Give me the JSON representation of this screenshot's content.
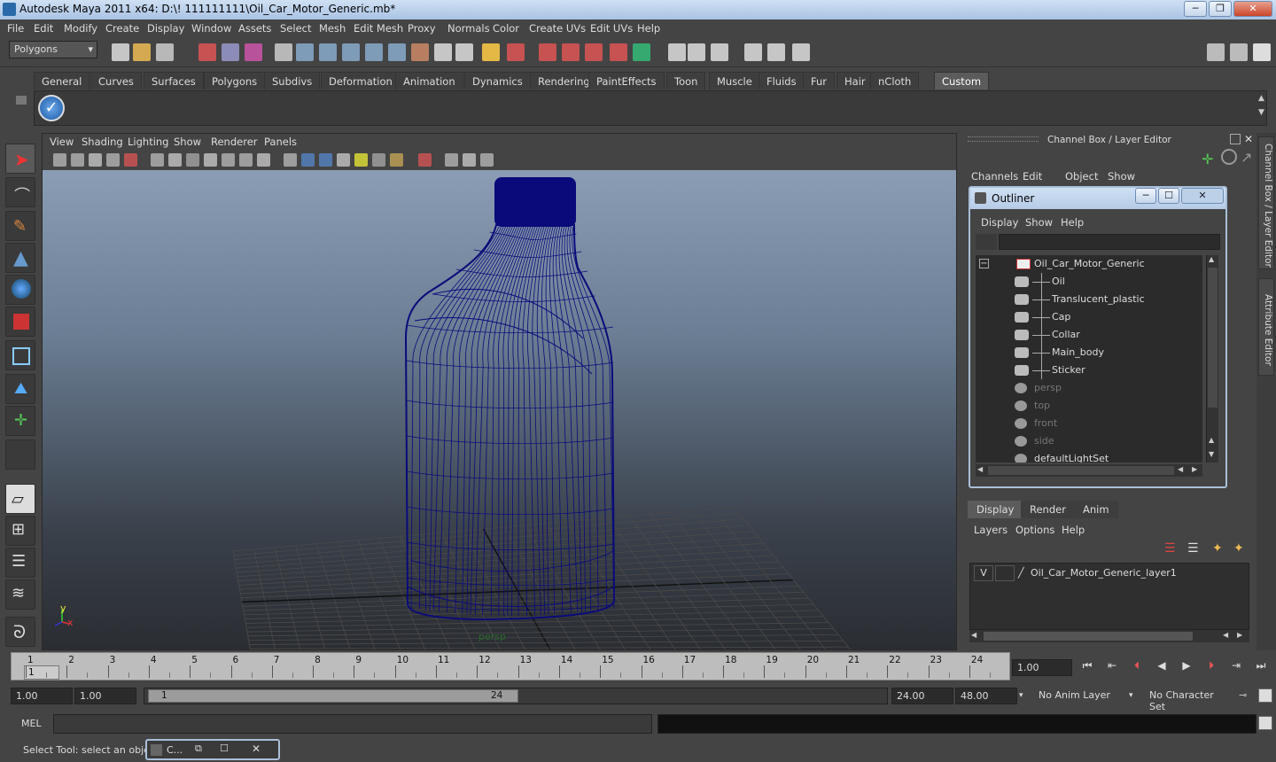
{
  "window": {
    "title": "Autodesk Maya 2011 x64: D:\\! 111111111\\Oil_Car_Motor_Generic.mb*",
    "btn_min": "─",
    "btn_max": "❐",
    "btn_close": "✕"
  },
  "menubar": [
    "File",
    "Edit",
    "Modify",
    "Create",
    "Display",
    "Window",
    "Assets",
    "Select",
    "Mesh",
    "Edit Mesh",
    "Proxy",
    "Normals",
    "Color",
    "Create UVs",
    "Edit UVs",
    "Help"
  ],
  "statusline": {
    "mode": "Polygons"
  },
  "shelf": {
    "tabs": [
      "General",
      "Curves",
      "Surfaces",
      "Polygons",
      "Subdivs",
      "Deformation",
      "Animation",
      "Dynamics",
      "Rendering",
      "PaintEffects",
      "Toon",
      "Muscle",
      "Fluids",
      "Fur",
      "Hair",
      "nCloth",
      "Custom"
    ],
    "active": "Custom"
  },
  "viewport": {
    "menu": [
      "View",
      "Shading",
      "Lighting",
      "Show",
      "Renderer",
      "Panels"
    ],
    "camera_label": "persp",
    "axis_y": "y",
    "axis_x": "x",
    "wire_color": "#0a0a7a"
  },
  "channelbox": {
    "title": "Channel Box / Layer Editor",
    "menu": [
      "Channels",
      "Edit",
      "Object",
      "Show"
    ]
  },
  "outliner": {
    "title": "Outliner",
    "menu": [
      "Display",
      "Show",
      "Help"
    ],
    "collapse": "−",
    "items": [
      {
        "label": "Oil_Car_Motor_Generic",
        "indent": 0,
        "dim": false
      },
      {
        "label": "Oil",
        "indent": 1,
        "dim": false
      },
      {
        "label": "Translucent_plastic",
        "indent": 1,
        "dim": false
      },
      {
        "label": "Cap",
        "indent": 1,
        "dim": false
      },
      {
        "label": "Collar",
        "indent": 1,
        "dim": false
      },
      {
        "label": "Main_body",
        "indent": 1,
        "dim": false
      },
      {
        "label": "Sticker",
        "indent": 1,
        "dim": false
      },
      {
        "label": "persp",
        "indent": 0,
        "dim": true
      },
      {
        "label": "top",
        "indent": 0,
        "dim": true
      },
      {
        "label": "front",
        "indent": 0,
        "dim": true
      },
      {
        "label": "side",
        "indent": 0,
        "dim": true
      },
      {
        "label": "defaultLightSet",
        "indent": 0,
        "dim": false
      }
    ]
  },
  "layers": {
    "tabs": [
      "Display",
      "Render",
      "Anim"
    ],
    "active": "Display",
    "menu": [
      "Layers",
      "Options",
      "Help"
    ],
    "rows": [
      {
        "visible": "V",
        "name": "Oil_Car_Motor_Generic_layer1"
      }
    ]
  },
  "sidetabs": [
    "Channel Box / Layer Editor",
    "Attribute Editor"
  ],
  "timeline": {
    "ticks": [
      "1",
      "2",
      "3",
      "4",
      "5",
      "6",
      "7",
      "8",
      "9",
      "10",
      "11",
      "12",
      "13",
      "14",
      "15",
      "16",
      "17",
      "18",
      "19",
      "20",
      "21",
      "22",
      "23",
      "24"
    ],
    "current_frame": "1",
    "current_time": "1.00"
  },
  "range": {
    "start": "1.00",
    "start2": "1.00",
    "slider_start": "1",
    "slider_end": "24",
    "end": "24.00",
    "end2": "48.00",
    "anim_layer": "No Anim Layer",
    "char_set": "No Character Set"
  },
  "cmdline": {
    "label": "MEL"
  },
  "helpline": {
    "text": "Select Tool: select an object",
    "mini_title": "C..."
  }
}
